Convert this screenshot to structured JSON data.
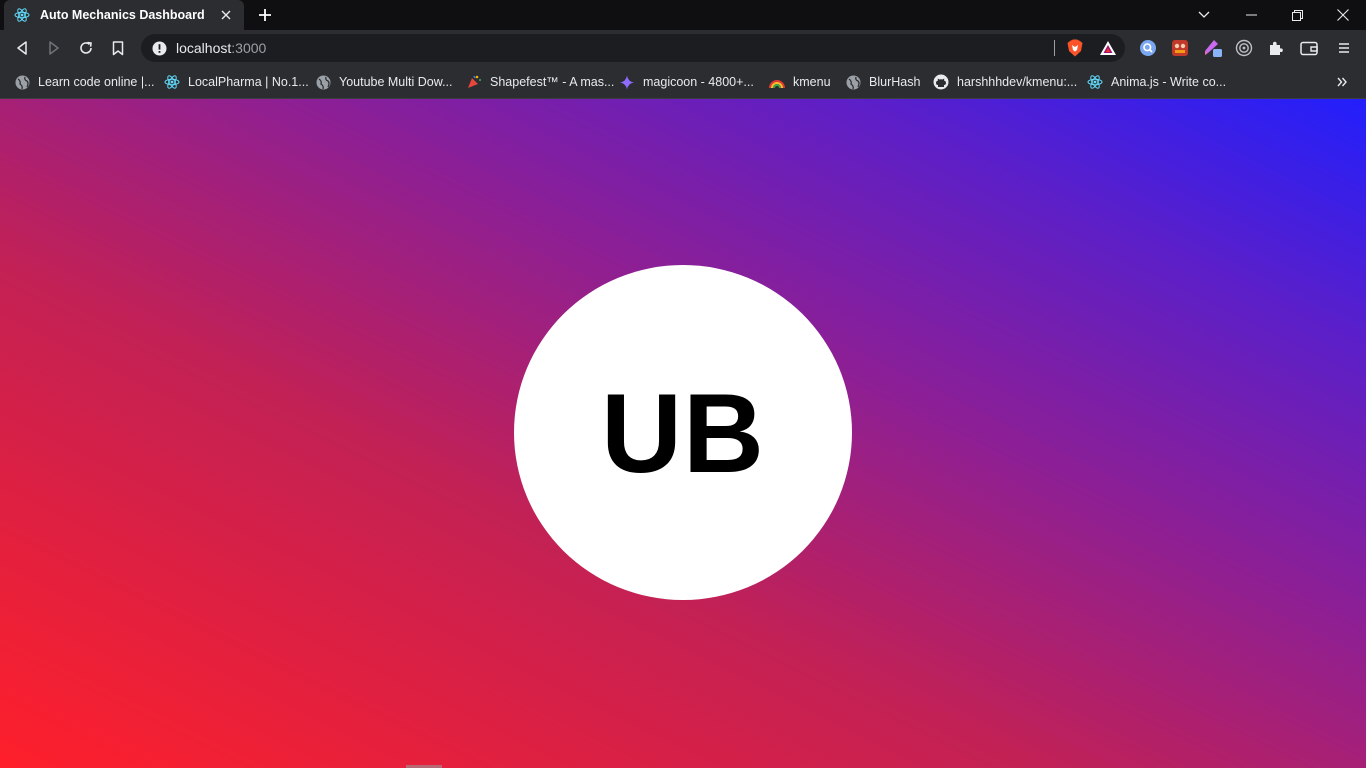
{
  "browser": {
    "tab": {
      "title": "Auto Mechanics Dashboard",
      "favicon": "react-icon"
    },
    "address": {
      "host": "localhost",
      "port": ":3000"
    },
    "window_controls": [
      "minimize-icon",
      "restore-icon",
      "close-icon"
    ],
    "bookmarks": [
      {
        "label": "Learn code online |...",
        "icon": "globe-icon"
      },
      {
        "label": "LocalPharma | No.1...",
        "icon": "react-icon"
      },
      {
        "label": "Youtube Multi Dow...",
        "icon": "globe-icon"
      },
      {
        "label": "Shapefest™ - A mas...",
        "icon": "party-popper-icon"
      },
      {
        "label": "magicoon - 4800+...",
        "icon": "sparkle-icon"
      },
      {
        "label": "kmenu",
        "icon": "rainbow-icon"
      },
      {
        "label": "BlurHash",
        "icon": "globe-icon"
      },
      {
        "label": "harshhhdev/kmenu:...",
        "icon": "github-icon"
      },
      {
        "label": "Anima.js - Write co...",
        "icon": "react-icon"
      }
    ]
  },
  "page": {
    "logo_text": "UB",
    "colors": {
      "gradient_start": "#ff1f2a",
      "gradient_end": "#221ffc",
      "circle": "#ffffff",
      "text": "#000000"
    }
  }
}
